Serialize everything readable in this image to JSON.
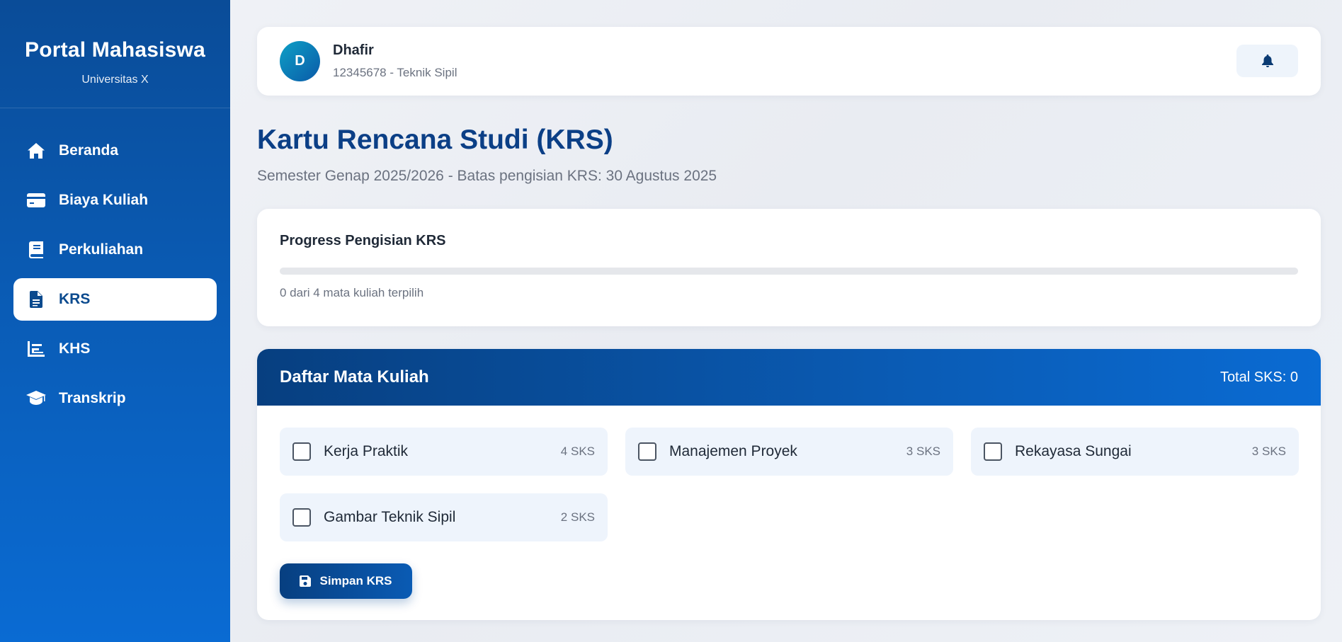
{
  "sidebar": {
    "brand_title": "Portal Mahasiswa",
    "brand_subtitle": "Universitas X",
    "items": [
      {
        "label": "Beranda",
        "icon": "home-icon"
      },
      {
        "label": "Biaya Kuliah",
        "icon": "credit-card-icon"
      },
      {
        "label": "Perkuliahan",
        "icon": "book-icon"
      },
      {
        "label": "KRS",
        "icon": "document-icon",
        "active": true
      },
      {
        "label": "KHS",
        "icon": "chart-icon"
      },
      {
        "label": "Transkrip",
        "icon": "graduation-cap-icon"
      }
    ]
  },
  "header": {
    "avatar_initial": "D",
    "user_name": "Dhafir",
    "user_meta": "12345678 - Teknik Sipil",
    "notification_icon": "bell-icon"
  },
  "page": {
    "title": "Kartu Rencana Studi (KRS)",
    "subtitle": "Semester Genap 2025/2026 - Batas pengisian KRS: 30 Agustus 2025"
  },
  "progress": {
    "title": "Progress Pengisian KRS",
    "fraction": 0,
    "text": "0 dari 4 mata kuliah terpilih"
  },
  "courses": {
    "title": "Daftar Mata Kuliah",
    "total_label": "Total SKS: 0",
    "items": [
      {
        "name": "Kerja Praktik",
        "sks": "4 SKS",
        "checked": false
      },
      {
        "name": "Manajemen Proyek",
        "sks": "3 SKS",
        "checked": false
      },
      {
        "name": "Rekayasa Sungai",
        "sks": "3 SKS",
        "checked": false
      },
      {
        "name": "Gambar Teknik Sipil",
        "sks": "2 SKS",
        "checked": false
      }
    ],
    "save_label": "Simpan KRS",
    "save_icon": "save-icon"
  },
  "colors": {
    "primary": "#0a5bb4",
    "primary_dark": "#073f80",
    "title": "#0b3f86",
    "course_bg": "#eef4fc"
  }
}
